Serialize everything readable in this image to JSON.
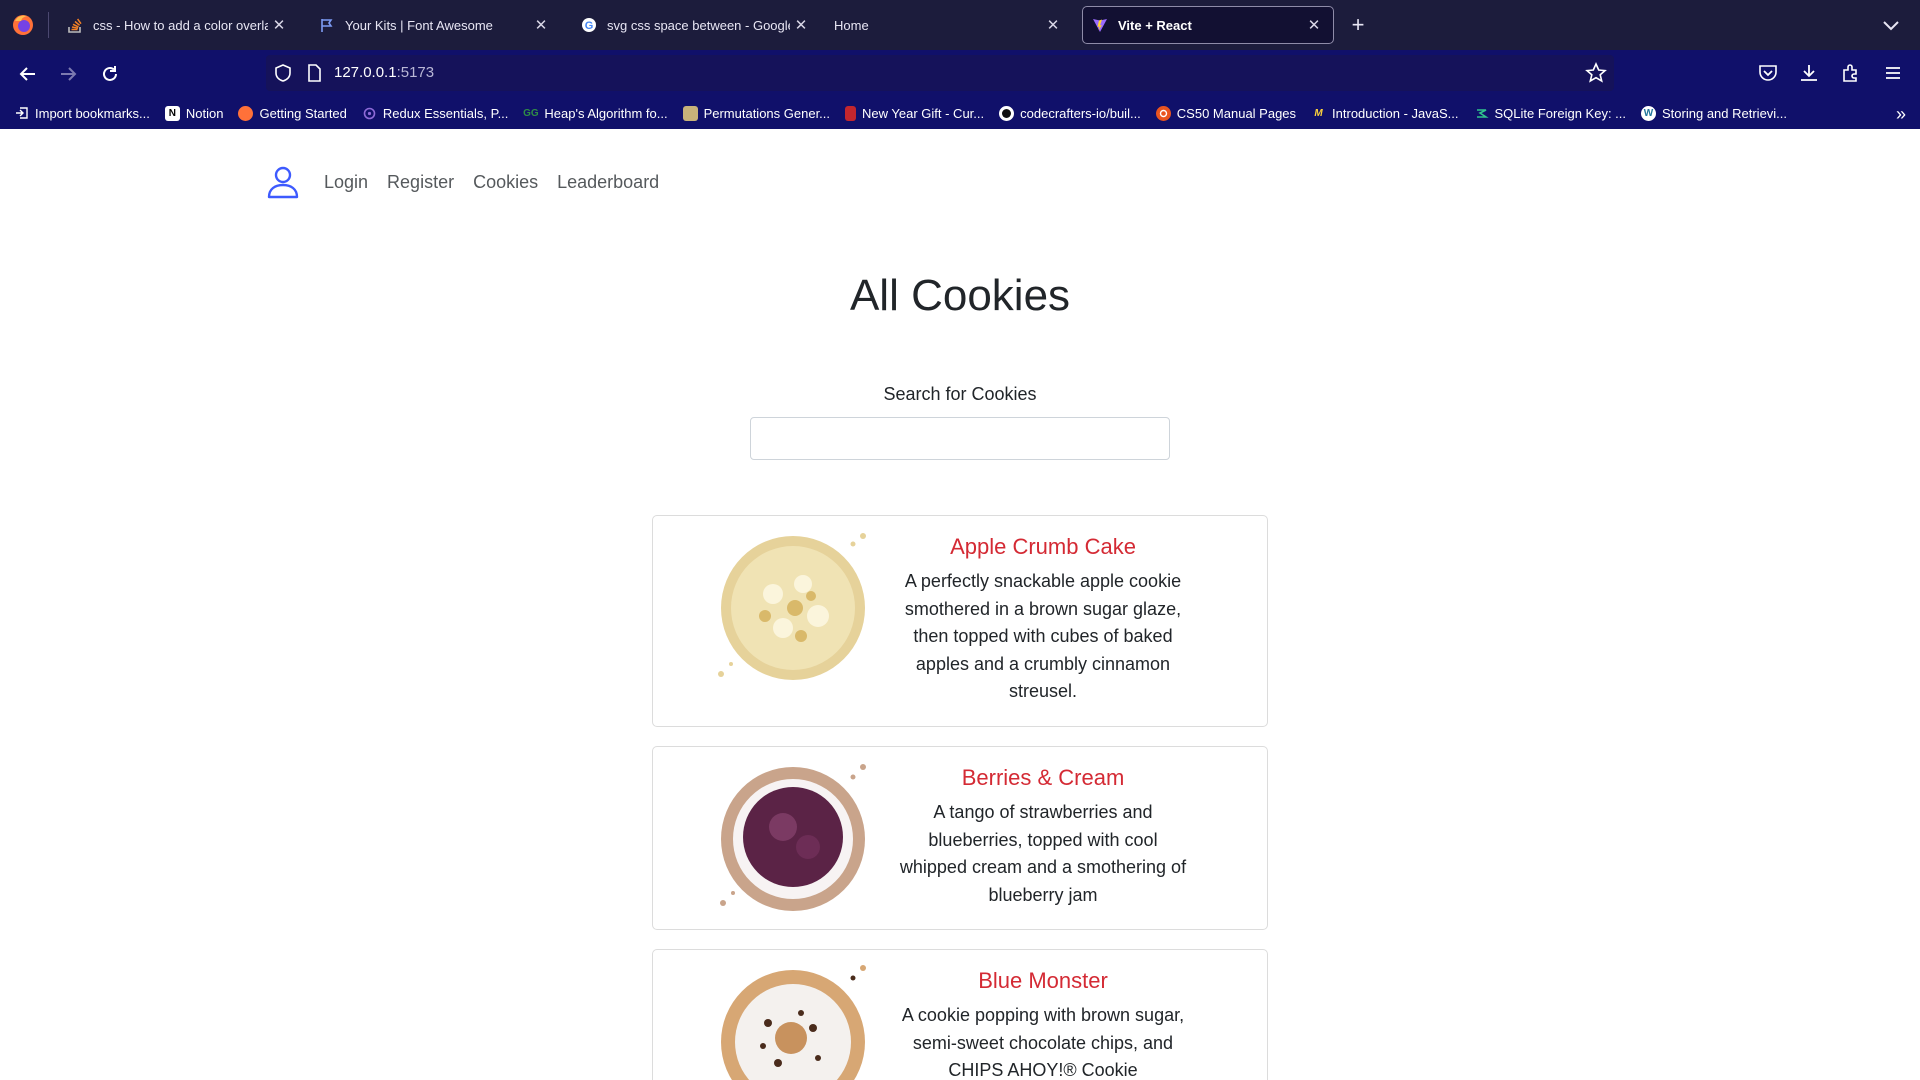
{
  "browser": {
    "tabs": [
      {
        "title": "css - How to add a color overlay",
        "icon": "stackoverflow-icon"
      },
      {
        "title": "Your Kits | Font Awesome",
        "icon": "fontawesome-flag-icon"
      },
      {
        "title": "svg css space between - Google",
        "icon": "google-icon"
      },
      {
        "title": "Home",
        "icon": "blank-page-icon"
      },
      {
        "title": "Vite + React",
        "icon": "vite-icon",
        "active": true
      }
    ],
    "url": {
      "host": "127.0.0.1",
      "port": ":5173"
    },
    "bookmarks": [
      {
        "label": "Import bookmarks...",
        "icon": "import-icon"
      },
      {
        "label": "Notion",
        "icon": "notion-icon"
      },
      {
        "label": "Getting Started",
        "icon": "firefox-icon"
      },
      {
        "label": "Redux Essentials, P...",
        "icon": "redux-icon"
      },
      {
        "label": "Heap's Algorithm fo...",
        "icon": "geeksforgeeks-icon"
      },
      {
        "label": "Permutations Gener...",
        "icon": "image-icon"
      },
      {
        "label": "New Year Gift - Cur...",
        "icon": "book-icon"
      },
      {
        "label": "codecrafters-io/buil...",
        "icon": "github-icon"
      },
      {
        "label": "CS50 Manual Pages",
        "icon": "ubuntu-icon"
      },
      {
        "label": "Introduction - JavaS...",
        "icon": "mdn-icon"
      },
      {
        "label": "SQLite Foreign Key: ...",
        "icon": "sqlite-icon"
      },
      {
        "label": "Storing and Retrievi...",
        "icon": "wordpress-icon"
      }
    ]
  },
  "site": {
    "nav": {
      "login": "Login",
      "register": "Register",
      "cookies": "Cookies",
      "leaderboard": "Leaderboard"
    },
    "title": "All Cookies",
    "search": {
      "label": "Search for Cookies",
      "value": "",
      "placeholder": ""
    },
    "cookies": [
      {
        "name": "Apple Crumb Cake",
        "description": "A perfectly snackable apple cookie smothered in a brown sugar glaze, then topped with cubes of baked apples and a crumbly cinnamon streusel.",
        "image": "apple-crumb-cake-cookie"
      },
      {
        "name": "Berries & Cream",
        "description": "A tango of strawberries and blueberries, topped with cool whipped cream and a smothering of blueberry jam",
        "image": "berries-cream-cookie"
      },
      {
        "name": "Blue Monster",
        "description": "A cookie popping with brown sugar, semi-sweet chocolate chips, and CHIPS AHOY!® Cookie",
        "image": "blue-monster-cookie"
      }
    ],
    "colors": {
      "accent": "#d42a34",
      "user_icon": "#3d5afe",
      "chrome": "#10106a"
    }
  }
}
